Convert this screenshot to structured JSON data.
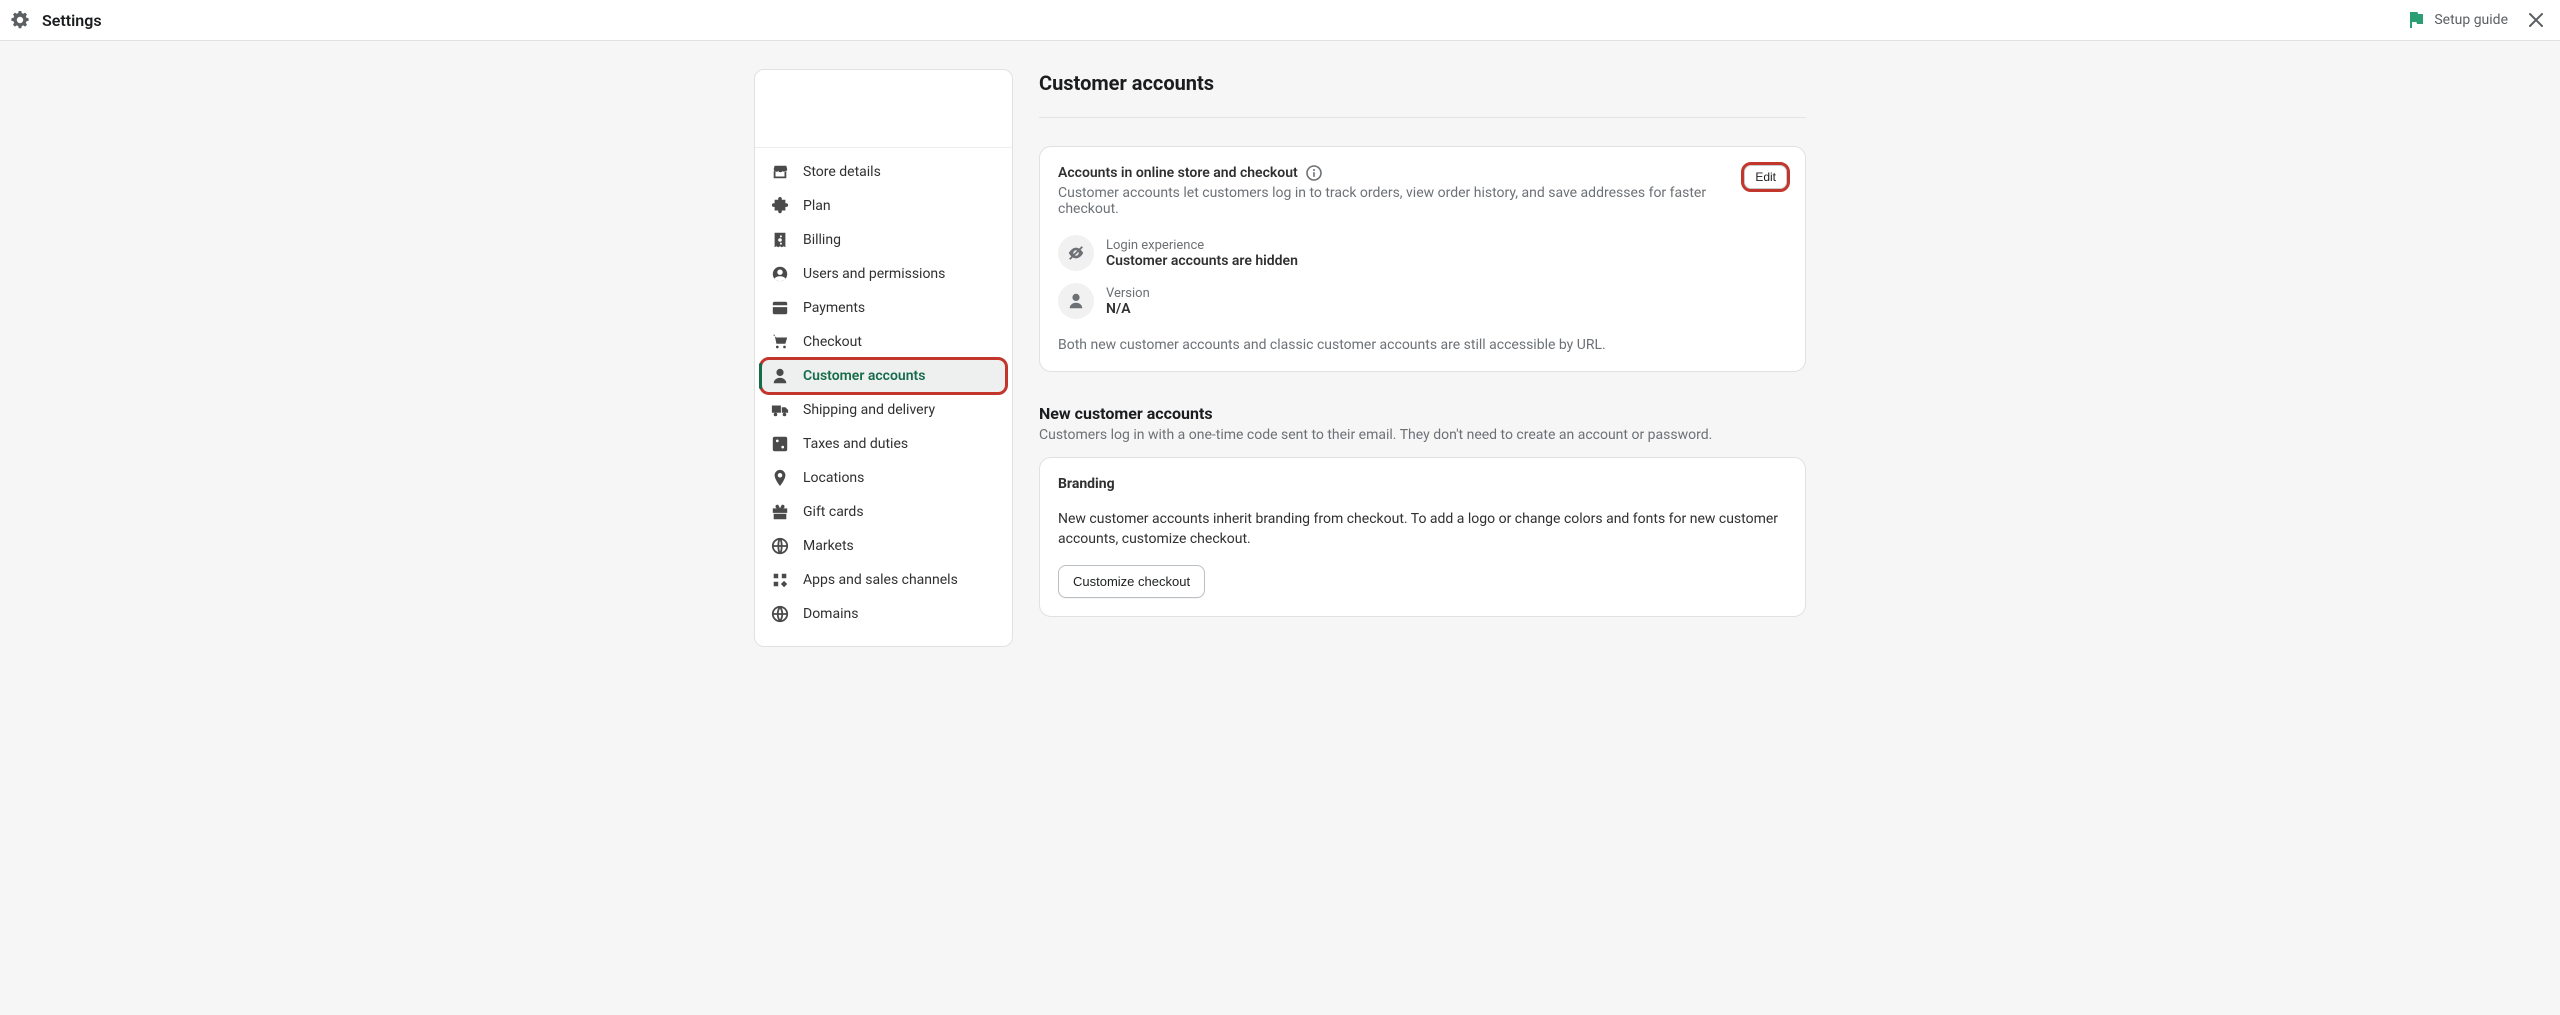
{
  "header": {
    "title": "Settings",
    "setup_guide": "Setup guide"
  },
  "page": {
    "title": "Customer accounts"
  },
  "sidebar": {
    "items": [
      {
        "label": "Store details",
        "icon": "store-icon"
      },
      {
        "label": "Plan",
        "icon": "puzzle-icon"
      },
      {
        "label": "Billing",
        "icon": "receipt-icon"
      },
      {
        "label": "Users and permissions",
        "icon": "user-circle-icon"
      },
      {
        "label": "Payments",
        "icon": "card-icon"
      },
      {
        "label": "Checkout",
        "icon": "cart-icon"
      },
      {
        "label": "Customer accounts",
        "icon": "person-icon",
        "active": true,
        "highlighted": true
      },
      {
        "label": "Shipping and delivery",
        "icon": "truck-icon"
      },
      {
        "label": "Taxes and duties",
        "icon": "percent-icon"
      },
      {
        "label": "Locations",
        "icon": "pin-icon"
      },
      {
        "label": "Gift cards",
        "icon": "gift-icon"
      },
      {
        "label": "Markets",
        "icon": "globe-icon"
      },
      {
        "label": "Apps and sales channels",
        "icon": "apps-icon"
      },
      {
        "label": "Domains",
        "icon": "domain-icon"
      }
    ]
  },
  "accounts_card": {
    "title": "Accounts in online store and checkout",
    "subtitle": "Customer accounts let customers log in to track orders, view order history, and save addresses for faster checkout.",
    "edit_label": "Edit",
    "login_experience_label": "Login experience",
    "login_experience_value": "Customer accounts are hidden",
    "version_label": "Version",
    "version_value": "N/A",
    "footnote": "Both new customer accounts and classic customer accounts are still accessible by URL."
  },
  "new_accounts": {
    "title": "New customer accounts",
    "subtitle": "Customers log in with a one-time code sent to their email. They don't need to create an account or password."
  },
  "branding_card": {
    "title": "Branding",
    "body": "New customer accounts inherit branding from checkout. To add a logo or change colors and fonts for new customer accounts, customize checkout.",
    "cta": "Customize checkout"
  }
}
